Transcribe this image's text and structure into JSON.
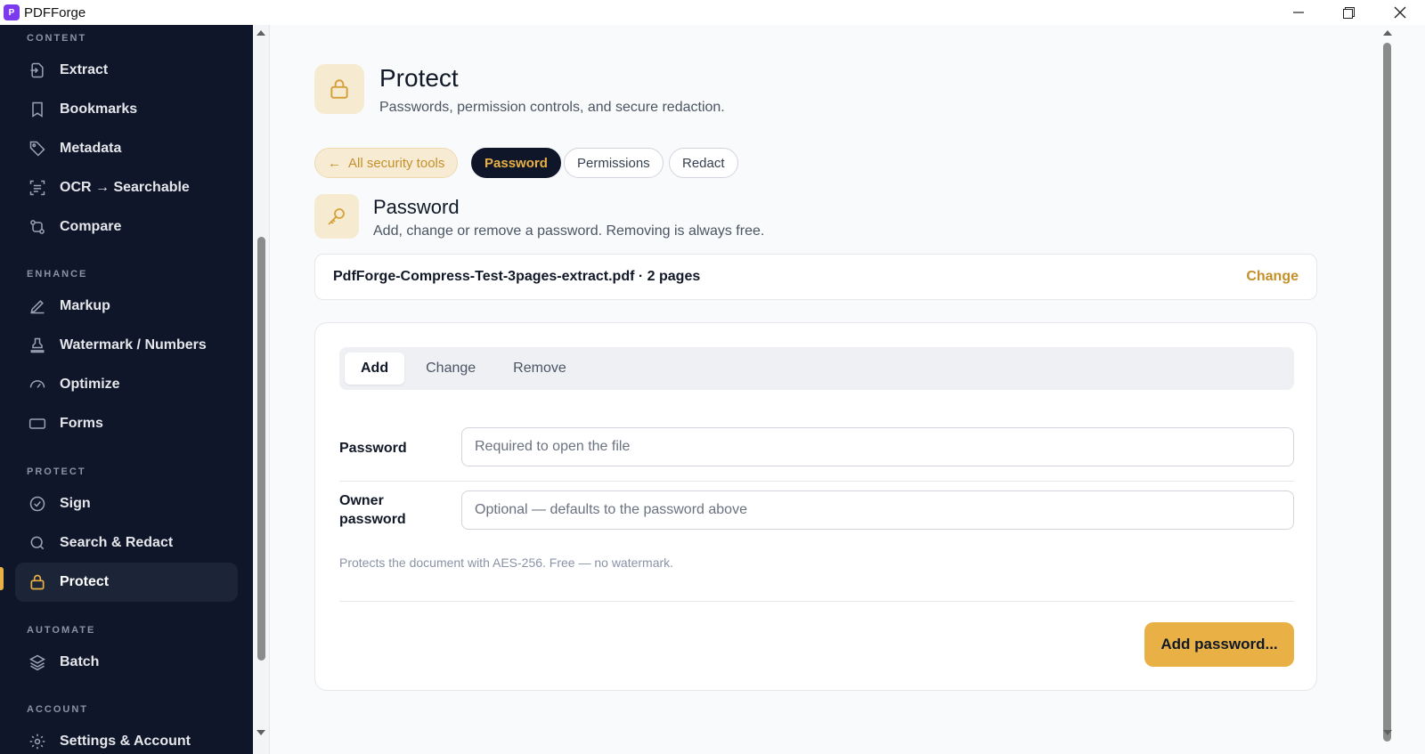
{
  "app": {
    "title": "PDFForge",
    "logo_letter": "P"
  },
  "window_controls": {
    "minimize": "—",
    "maximize": "❐",
    "close": "✕"
  },
  "sidebar": {
    "sections": [
      {
        "label": "CONTENT"
      },
      {
        "label": "ENHANCE"
      },
      {
        "label": "PROTECT"
      },
      {
        "label": "AUTOMATE"
      },
      {
        "label": "ACCOUNT"
      }
    ],
    "items": [
      {
        "label": "Extract",
        "icon": "extract-icon"
      },
      {
        "label": "Bookmarks",
        "icon": "bookmark-icon"
      },
      {
        "label": "Metadata",
        "icon": "tag-icon"
      },
      {
        "label": "OCR → Searchable",
        "icon": "scan-text-icon"
      },
      {
        "label": "Compare",
        "icon": "compare-icon"
      },
      {
        "label": "Markup",
        "icon": "pen-icon"
      },
      {
        "label": "Watermark / Numbers",
        "icon": "stamp-icon"
      },
      {
        "label": "Optimize",
        "icon": "gauge-icon"
      },
      {
        "label": "Forms",
        "icon": "form-icon"
      },
      {
        "label": "Sign",
        "icon": "badge-check-icon"
      },
      {
        "label": "Search & Redact",
        "icon": "search-icon"
      },
      {
        "label": "Protect",
        "icon": "lock-icon",
        "active": true
      },
      {
        "label": "Batch",
        "icon": "layers-icon"
      },
      {
        "label": "Settings & Account",
        "icon": "settings-icon"
      }
    ],
    "accent_color": "#e9b145"
  },
  "header": {
    "title": "Protect",
    "subtitle": "Passwords, permission controls, and secure redaction."
  },
  "pills": {
    "back": "All security tools",
    "items": [
      "Password",
      "Permissions",
      "Redact"
    ],
    "active": "Password"
  },
  "tool": {
    "title": "Password",
    "description": "Add, change or remove a password. Removing is always free."
  },
  "file": {
    "name": "PdfForge-Compress-Test-3pages-extract.pdf · 2 pages",
    "change_label": "Change"
  },
  "panel": {
    "tabs": [
      "Add",
      "Change",
      "Remove"
    ],
    "active_tab": "Add",
    "password": {
      "label": "Password",
      "placeholder": "Required to open the file",
      "value": ""
    },
    "owner_password": {
      "label_line1": "Owner",
      "label_line2": "password",
      "placeholder": "Optional — defaults to the password above",
      "value": ""
    },
    "note": "Protects the document with AES-256. Free — no watermark.",
    "submit": "Add password..."
  }
}
